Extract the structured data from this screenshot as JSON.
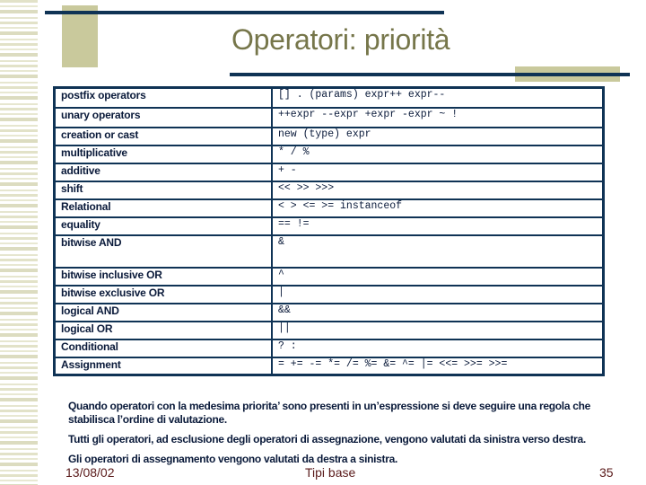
{
  "slide": {
    "title": "Operatori: priorità",
    "table": {
      "rows": [
        {
          "category": "postfix operators",
          "operators": "[]  .  (params)  expr++  expr--"
        },
        {
          "category": "unary operators",
          "operators": "++expr  --expr  +expr  -expr  ~  !"
        },
        {
          "category": "creation or cast",
          "operators": "new  (type) expr"
        },
        {
          "category": "multiplicative",
          "operators": "*  /  %"
        },
        {
          "category": "additive",
          "operators": "+  -"
        },
        {
          "category": "shift",
          "operators": "<< >> >>>"
        },
        {
          "category": "Relational",
          "operators": "< > <= >= instanceof"
        },
        {
          "category": "equality",
          "operators": "== !="
        },
        {
          "category": "bitwise AND",
          "operators": "&"
        },
        {
          "category": "bitwise inclusive OR",
          "operators": "^"
        },
        {
          "category": "bitwise exclusive OR",
          "operators": "|"
        },
        {
          "category": "logical AND",
          "operators": "&&"
        },
        {
          "category": "logical OR",
          "operators": "||"
        },
        {
          "category": "Conditional",
          "operators": "?  :"
        },
        {
          "category": "Assignment",
          "operators": "=  +=  -=  *=  /=  %=  &=  ^=  |=  <<=  >>=  >>="
        }
      ]
    },
    "notes": [
      "Quando operatori con la medesima priorita’ sono presenti in un’espressione si deve seguire una regola che stabilisca l’ordine di valutazione.",
      "Tutti gli operatori, ad esclusione degli operatori di assegnazione, vengono valutati da sinistra verso destra.",
      "Gli operatori di assegnamento vengono valutati da destra a sinistra."
    ],
    "footer": {
      "date": "13/08/02",
      "center": "Tipi base",
      "page": "35"
    }
  }
}
